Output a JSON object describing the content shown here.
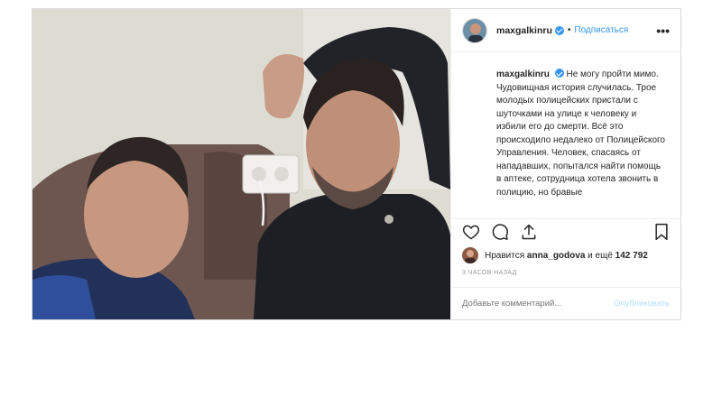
{
  "post": {
    "username": "maxgalkinru",
    "follow_label": "Подписаться",
    "more_label": "•••",
    "caption": "Не могу пройти мимо. Чудовищная история случилась. Трое молодых полицейских пристали с шуточками на улице к человеку и избили его до смерти. Всё это происходило недалеко от Полицейского Управления. Человек, спасаясь от нападавших, попытался найти помощь в аптеке, сотрудница хотела звонить в полицию, но бравые",
    "likes_prefix": "Нравится",
    "likes_user": "anna_godova",
    "likes_suffix": "и ещё",
    "likes_count": "142 792",
    "time": "3 часов назад",
    "comment_placeholder": "Добавьте комментарий...",
    "publish_label": "Опубликовать"
  },
  "icons": {
    "like": "heart-icon",
    "comment": "comment-icon",
    "share": "share-icon",
    "save": "bookmark-icon",
    "verified": "verified-badge-icon",
    "more": "more-options-icon"
  },
  "colors": {
    "link_blue": "#3897f0",
    "publish_disabled": "#b2dffc",
    "border": "#dbdbdb"
  }
}
